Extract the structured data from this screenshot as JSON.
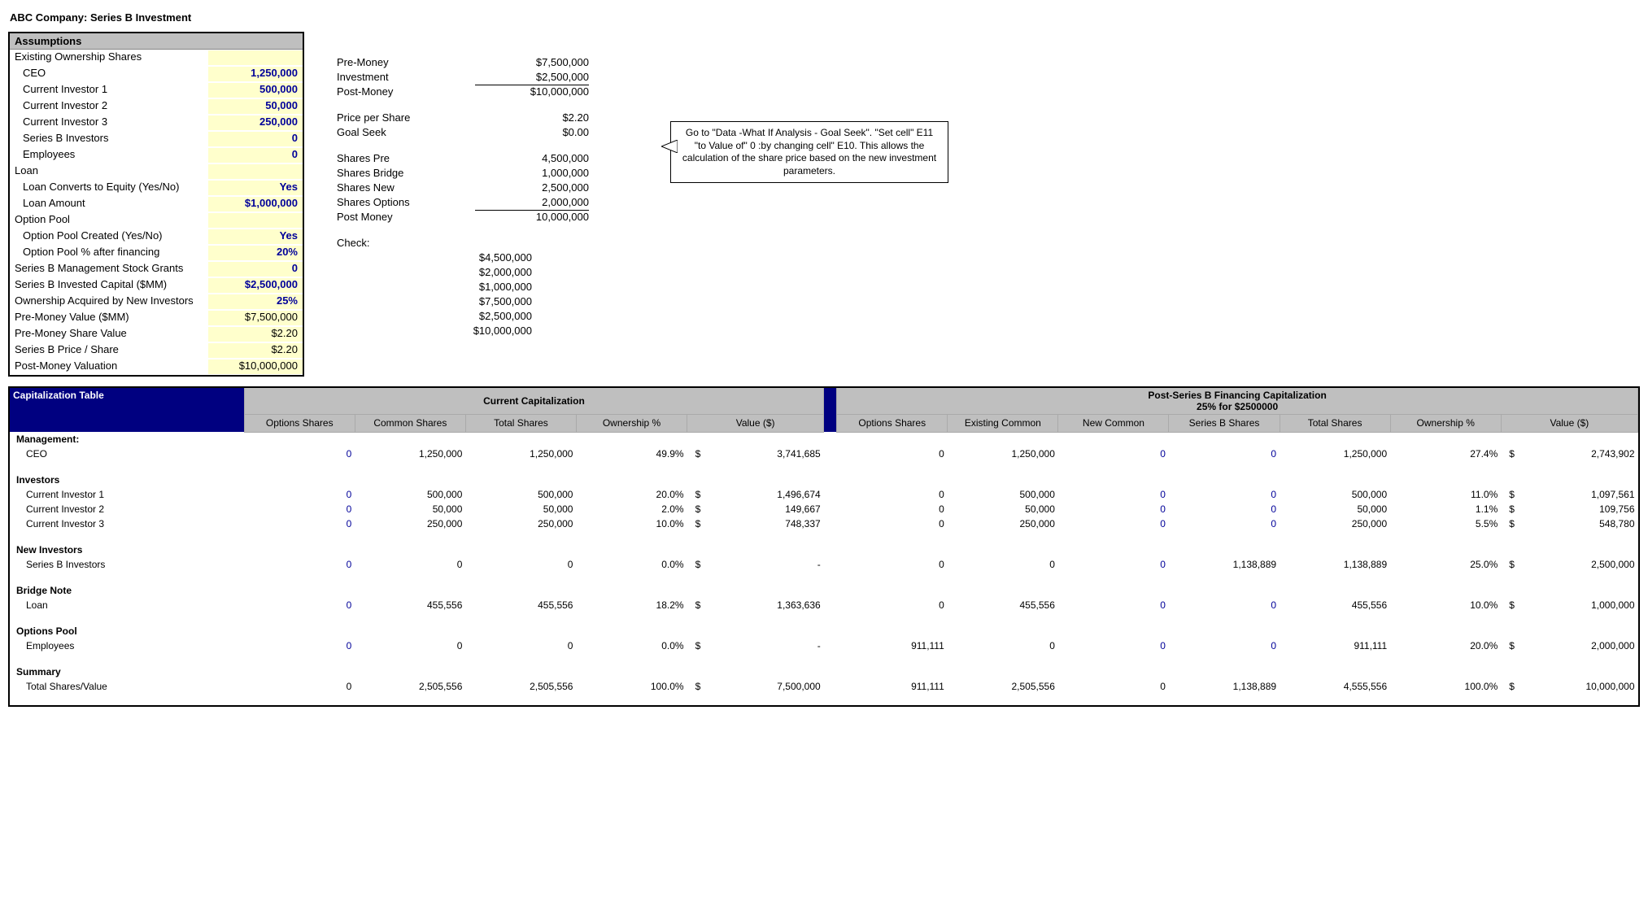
{
  "title": "ABC Company: Series B Investment",
  "assumptions": {
    "header": "Assumptions",
    "existing_ownership_label": "Existing Ownership Shares",
    "ceo_label": "CEO",
    "ceo": "1,250,000",
    "inv1_label": "Current Investor 1",
    "inv1": "500,000",
    "inv2_label": "Current Investor 2",
    "inv2": "50,000",
    "inv3_label": "Current Investor 3",
    "inv3": "250,000",
    "seriesb_label": "Series B Investors",
    "seriesb": "0",
    "employees_label": "Employees",
    "employees": "0",
    "loan_label": "Loan",
    "loan_convert_label": "Loan Converts to Equity (Yes/No)",
    "loan_convert": "Yes",
    "loan_amount_label": "Loan Amount",
    "loan_amount": "$1,000,000",
    "optpool_label": "Option Pool",
    "optpool_created_label": "Option Pool Created (Yes/No)",
    "optpool_created": "Yes",
    "optpool_pct_label": "Option Pool % after financing",
    "optpool_pct": "20%",
    "mgmt_grants_label": "Series B Management Stock Grants",
    "mgmt_grants": "0",
    "invested_label": "Series B Invested Capital ($MM)",
    "invested": "$2,500,000",
    "acquired_label": "Ownership Acquired by New Investors",
    "acquired": "25%",
    "premoney_label": "Pre-Money Value ($MM)",
    "premoney": "$7,500,000",
    "presharev_label": "Pre-Money Share Value",
    "presharev": "$2.20",
    "seriesb_price_label": "Series B Price / Share",
    "seriesb_price": "$2.20",
    "postval_label": "Post-Money Valuation",
    "postval": "$10,000,000"
  },
  "calc": {
    "premoney_label": "Pre-Money",
    "premoney": "$7,500,000",
    "investment_label": "Investment",
    "investment": "$2,500,000",
    "postmoney_label": "Post-Money",
    "postmoney": "$10,000,000",
    "pps_label": "Price per Share",
    "pps": "$2.20",
    "goalseek_label": "Goal Seek",
    "goalseek": "$0.00",
    "shares_pre_label": "Shares Pre",
    "shares_pre": "4,500,000",
    "shares_bridge_label": "Shares Bridge",
    "shares_bridge": "1,000,000",
    "shares_new_label": "Shares New",
    "shares_new": "2,500,000",
    "shares_options_label": "Shares Options",
    "shares_options": "2,000,000",
    "shares_post_label": "Post Money",
    "shares_post": "10,000,000",
    "check_label": "Check:",
    "check1": "$4,500,000",
    "check2": "$2,000,000",
    "check3": "$1,000,000",
    "check4": "$7,500,000",
    "check5": "$2,500,000",
    "check6": "$10,000,000"
  },
  "callout": "Go to \"Data -What If Analysis - Goal Seek\". \"Set cell\" E11 \"to Value of\" 0 :by changing cell\" E10.  This allows the calculation of the share price based on the new investment parameters.",
  "cap": {
    "header": "Capitalization Table",
    "current_group": "Current Capitalization",
    "post_group_line1": "Post-Series B Financing Capitalization",
    "post_group_line2": "25% for $2500000",
    "cols": {
      "options": "Options Shares",
      "common": "Common Shares",
      "total": "Total Shares",
      "own": "Ownership %",
      "value": "Value ($)",
      "options2": "Options Shares",
      "exist": "Existing Common",
      "newc": "New Common",
      "sbshares": "Series B Shares",
      "total2": "Total Shares",
      "own2": "Ownership %",
      "value2": "Value ($)"
    },
    "mgmt_label": "Management:",
    "ceo": {
      "label": "CEO",
      "opt": "0",
      "com": "1,250,000",
      "tot": "1,250,000",
      "own": "49.9%",
      "val": "3,741,685",
      "opt2": "0",
      "exist": "1,250,000",
      "newc": "0",
      "sb": "0",
      "tot2": "1,250,000",
      "own2": "27.4%",
      "val2": "2,743,902"
    },
    "investors_label": "Investors",
    "inv1": {
      "label": "Current Investor 1",
      "opt": "0",
      "com": "500,000",
      "tot": "500,000",
      "own": "20.0%",
      "val": "1,496,674",
      "opt2": "0",
      "exist": "500,000",
      "newc": "0",
      "sb": "0",
      "tot2": "500,000",
      "own2": "11.0%",
      "val2": "1,097,561"
    },
    "inv2": {
      "label": "Current Investor 2",
      "opt": "0",
      "com": "50,000",
      "tot": "50,000",
      "own": "2.0%",
      "val": "149,667",
      "opt2": "0",
      "exist": "50,000",
      "newc": "0",
      "sb": "0",
      "tot2": "50,000",
      "own2": "1.1%",
      "val2": "109,756"
    },
    "inv3": {
      "label": "Current Investor 3",
      "opt": "0",
      "com": "250,000",
      "tot": "250,000",
      "own": "10.0%",
      "val": "748,337",
      "opt2": "0",
      "exist": "250,000",
      "newc": "0",
      "sb": "0",
      "tot2": "250,000",
      "own2": "5.5%",
      "val2": "548,780"
    },
    "new_investors_label": "New Investors",
    "seriesb": {
      "label": "Series B Investors",
      "opt": "0",
      "com": "0",
      "tot": "0",
      "own": "0.0%",
      "val": "-",
      "opt2": "0",
      "exist": "0",
      "newc": "0",
      "sb": "1,138,889",
      "tot2": "1,138,889",
      "own2": "25.0%",
      "val2": "2,500,000"
    },
    "bridge_label": "Bridge Note",
    "loan": {
      "label": "Loan",
      "opt": "0",
      "com": "455,556",
      "tot": "455,556",
      "own": "18.2%",
      "val": "1,363,636",
      "opt2": "0",
      "exist": "455,556",
      "newc": "0",
      "sb": "0",
      "tot2": "455,556",
      "own2": "10.0%",
      "val2": "1,000,000"
    },
    "options_label": "Options Pool",
    "emp": {
      "label": "Employees",
      "opt": "0",
      "com": "0",
      "tot": "0",
      "own": "0.0%",
      "val": "-",
      "opt2": "911,111",
      "exist": "0",
      "newc": "0",
      "sb": "0",
      "tot2": "911,111",
      "own2": "20.0%",
      "val2": "2,000,000"
    },
    "summary_label": "Summary",
    "total": {
      "label": "Total Shares/Value",
      "opt": "0",
      "com": "2,505,556",
      "tot": "2,505,556",
      "own": "100.0%",
      "val": "7,500,000",
      "opt2": "911,111",
      "exist": "2,505,556",
      "newc": "0",
      "sb": "1,138,889",
      "tot2": "4,555,556",
      "own2": "100.0%",
      "val2": "10,000,000"
    },
    "dollar": "$"
  }
}
